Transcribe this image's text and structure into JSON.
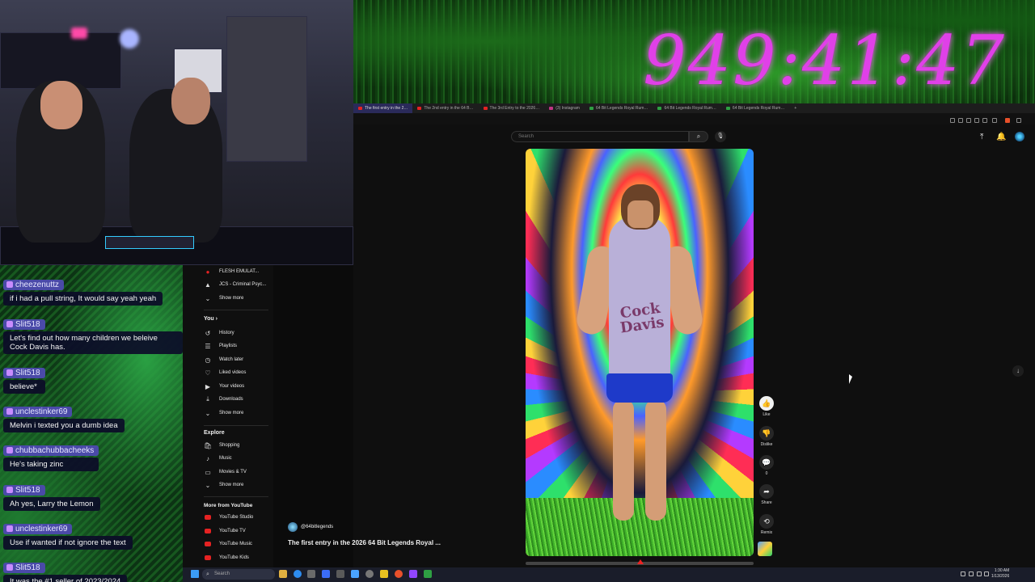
{
  "timer": "949:41:47",
  "tabs": [
    {
      "label": "The first entry in the 2…",
      "active": true,
      "color": "#e52222"
    },
    {
      "label": "The 2nd entry in the 64 B…",
      "active": false,
      "color": "#e52222"
    },
    {
      "label": "The 3rd Entry to the 2026…",
      "active": false,
      "color": "#e52222"
    },
    {
      "label": "(3) Instagram",
      "active": false,
      "color": "#c13584"
    },
    {
      "label": "64 Bit Legends Royal Rum…",
      "active": false,
      "color": "#2ea043"
    },
    {
      "label": "64 Bit Legends Royal Rum…",
      "active": false,
      "color": "#2ea043"
    },
    {
      "label": "64 Bit Legends Royal Rum…",
      "active": false,
      "color": "#2ea043"
    }
  ],
  "search": {
    "placeholder": "Search"
  },
  "chat": [
    {
      "user": "cheezenuttz",
      "text": "if i had a pull string, It would say yeah yeah"
    },
    {
      "user": "Slit518",
      "text": "Let's find out how many children we beleive Cock Davis has."
    },
    {
      "user": "Slit518",
      "text": "believe*"
    },
    {
      "user": "unclestinker69",
      "text": "Melvin i texted you a dumb idea"
    },
    {
      "user": "chubbachubbacheeks",
      "text": "He's taking zinc"
    },
    {
      "user": "Slit518",
      "text": "Ah yes, Larry the Lemon"
    },
    {
      "user": "unclestinker69",
      "text": "Use if wanted if not ignore the text"
    },
    {
      "user": "Slit518",
      "text": "It was the #1 seller of 2023/2024"
    }
  ],
  "sidebar": {
    "subs": [
      {
        "label": "FLESH EMULAT...",
        "icon": "●"
      },
      {
        "label": "JCS - Criminal Psyc...",
        "icon": "▲"
      }
    ],
    "show_more_1": "Show more",
    "you_heading": "You",
    "you_items": [
      {
        "label": "History",
        "icon": "↺"
      },
      {
        "label": "Playlists",
        "icon": "☰"
      },
      {
        "label": "Watch later",
        "icon": "◷"
      },
      {
        "label": "Liked videos",
        "icon": "♡"
      },
      {
        "label": "Your videos",
        "icon": "▶"
      },
      {
        "label": "Downloads",
        "icon": "⤓"
      }
    ],
    "show_more_2": "Show more",
    "explore_heading": "Explore",
    "explore_items": [
      {
        "label": "Shopping",
        "icon": "🛍"
      },
      {
        "label": "Music",
        "icon": "♪"
      },
      {
        "label": "Movies & TV",
        "icon": "▭"
      }
    ],
    "show_more_3": "Show more",
    "more_heading": "More from YouTube",
    "more_items": [
      {
        "label": "YouTube Studio"
      },
      {
        "label": "YouTube TV"
      },
      {
        "label": "YouTube Music"
      },
      {
        "label": "YouTube Kids"
      }
    ]
  },
  "video": {
    "shirt_text": "Cock Davis",
    "channel": "@64bitlegends",
    "title": "The first entry in the 2026 64 Bit Legends Royal ...",
    "progress": 0.49
  },
  "actions": [
    {
      "label": "Like",
      "icon": "👍"
    },
    {
      "label": "Dislike",
      "icon": "👎"
    },
    {
      "label": "0",
      "icon": "💬"
    },
    {
      "label": "Share",
      "icon": "➦"
    },
    {
      "label": "Remix",
      "icon": "⟲"
    }
  ],
  "taskbar": {
    "search_placeholder": "Search",
    "time": "1:30 AM",
    "date": "1/13/2026"
  }
}
